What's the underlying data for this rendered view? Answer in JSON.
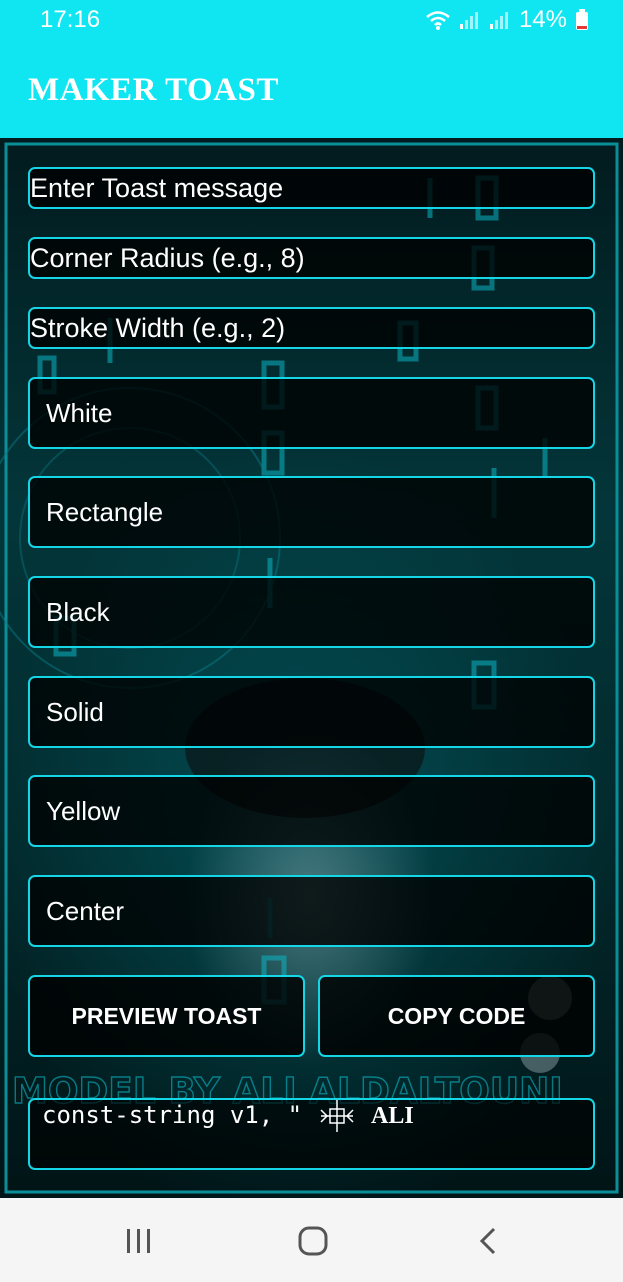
{
  "status_bar": {
    "time": "17:16",
    "battery": "14%"
  },
  "app": {
    "title": "MAKER TOAST"
  },
  "form": {
    "message_hint": "Enter Toast message",
    "radius_hint": "Corner Radius (e.g., 8)",
    "stroke_hint": "Stroke Width (e.g., 2)",
    "text_color": "White",
    "shape": "Rectangle",
    "background_color": "Black",
    "stroke_style": "Solid",
    "stroke_color": "Yellow",
    "gravity": "Center"
  },
  "buttons": {
    "preview": "PREVIEW TOAST",
    "copy": "COPY CODE"
  },
  "code_output": {
    "text": "const-string v1, \"",
    "signature": "ALI"
  },
  "background_banner": "MODEL BY ALI ALDALTOUNI",
  "colors": {
    "accent": "#0fe6f2",
    "border": "#14d6e6",
    "nav_bar": "#f5f5f5"
  }
}
